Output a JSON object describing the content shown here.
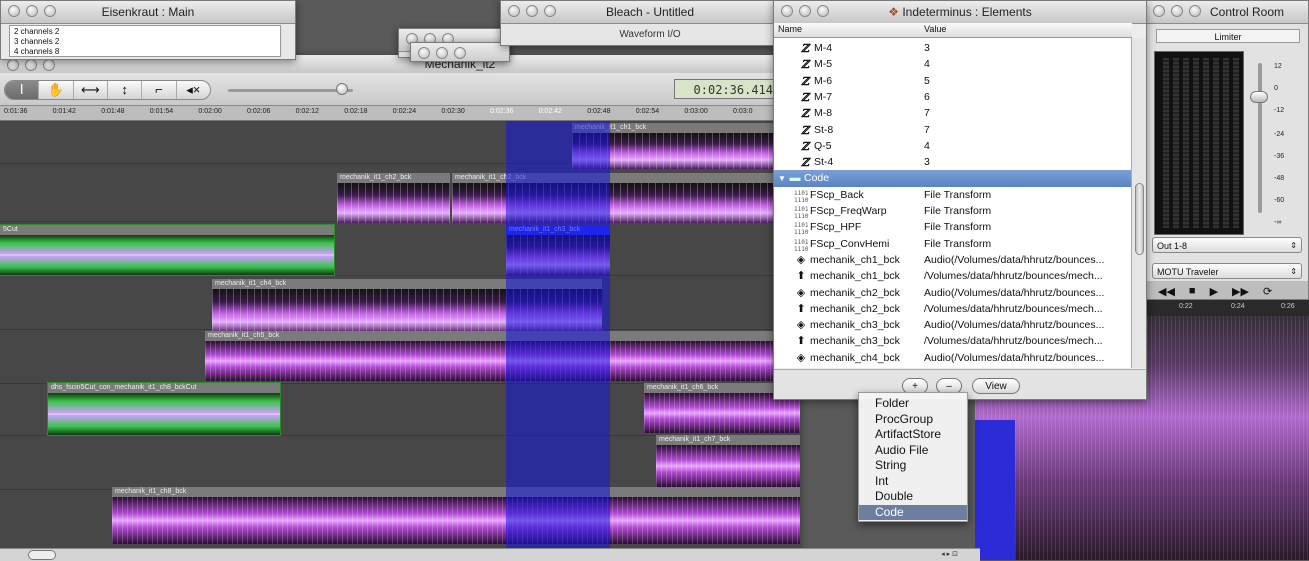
{
  "eisenkraut": {
    "title": "Eisenkraut : Main",
    "lines": [
      "2  channels 2",
      "3  channels 2",
      "4  channels 8"
    ]
  },
  "bleach": {
    "title": "Bleach - Untitled",
    "subtitle": "Waveform I/O"
  },
  "mechanik": {
    "title": "Mechanik_it2",
    "timecode": "0:02:36.414",
    "tools": [
      "Ⅰ",
      "✋",
      "⟷",
      "↕",
      "⌐",
      "◂×"
    ],
    "ruler_ticks": [
      "0:01:36",
      "0:01:42",
      "0:01:48",
      "0:01:54",
      "0:02:00",
      "0:02:06",
      "0:02:12",
      "0:02:18",
      "0:02:24",
      "0:02:30",
      "0:02:36",
      "0:02:42",
      "0:02:48",
      "0:02:54",
      "0:03:00",
      "0:03:0"
    ],
    "regions": [
      {
        "label": "mechanik_it1_ch1_bck"
      },
      {
        "label": "mechanik_it1_ch2_bck"
      },
      {
        "label": "mechanik_it1_ch2_bck"
      },
      {
        "label": "5Cut"
      },
      {
        "label": "mechanik_it1_ch3_bck"
      },
      {
        "label": "mechanik_it1_ch4_bck"
      },
      {
        "label": "mechanik_it1_ch5_bck"
      },
      {
        "label": "dhs_fscin5Cut_con_mechanik_it1_ch8_bckCut"
      },
      {
        "label": "mechanik_it1_ch6_bck"
      },
      {
        "label": "mechanik_it1_ch7_bck"
      },
      {
        "label": "mechanik_it1_ch8_bck"
      }
    ]
  },
  "elements": {
    "title": "Indeterminus : Elements",
    "col_name": "Name",
    "col_value": "Value",
    "rows": [
      {
        "name": "M-4",
        "value": "3",
        "icon": "Z"
      },
      {
        "name": "M-5",
        "value": "4",
        "icon": "Z"
      },
      {
        "name": "M-6",
        "value": "5",
        "icon": "Z"
      },
      {
        "name": "M-7",
        "value": "6",
        "icon": "Z"
      },
      {
        "name": "M-8",
        "value": "7",
        "icon": "Z"
      },
      {
        "name": "St-8",
        "value": "7",
        "icon": "Z"
      },
      {
        "name": "Q-5",
        "value": "4",
        "icon": "Z"
      },
      {
        "name": "St-4",
        "value": "3",
        "icon": "Z"
      },
      {
        "name": "Code",
        "value": "",
        "icon": "folder"
      },
      {
        "name": "FScp_Back",
        "value": "File Transform",
        "icon": "1101\n1110"
      },
      {
        "name": "FScp_FreqWarp",
        "value": "File Transform",
        "icon": "1101\n1110"
      },
      {
        "name": "FScp_HPF",
        "value": "File Transform",
        "icon": "1101\n1110"
      },
      {
        "name": "FScp_ConvHemi",
        "value": "File Transform",
        "icon": "1101\n1110"
      },
      {
        "name": "mechanik_ch1_bck",
        "value": "Audio(/Volumes/data/hhrutz/bounces...",
        "icon": "audio"
      },
      {
        "name": "mechanik_ch1_bck",
        "value": "/Volumes/data/hhrutz/bounces/mech...",
        "icon": "file"
      },
      {
        "name": "mechanik_ch2_bck",
        "value": "Audio(/Volumes/data/hhrutz/bounces...",
        "icon": "audio"
      },
      {
        "name": "mechanik_ch2_bck",
        "value": "/Volumes/data/hhrutz/bounces/mech...",
        "icon": "file"
      },
      {
        "name": "mechanik_ch3_bck",
        "value": "Audio(/Volumes/data/hhrutz/bounces...",
        "icon": "audio"
      },
      {
        "name": "mechanik_ch3_bck",
        "value": "/Volumes/data/hhrutz/bounces/mech...",
        "icon": "file"
      },
      {
        "name": "mechanik_ch4_bck",
        "value": "Audio(/Volumes/data/hhrutz/bounces...",
        "icon": "audio"
      }
    ],
    "buttons": {
      "add": "+",
      "remove": "–",
      "view": "View"
    }
  },
  "menu": {
    "items": [
      "Folder",
      "ProcGroup",
      "ArtifactStore",
      "Audio File",
      "String",
      "Int",
      "Double",
      "Code"
    ],
    "selected": "Code"
  },
  "control_room": {
    "title": "Control Room",
    "limiter": "Limiter",
    "scale": [
      "12",
      "0",
      "-12",
      "-24",
      "-36",
      "-48",
      "-60",
      "-∞"
    ],
    "output": "Out 1-8",
    "device": "MOTU Traveler",
    "transport": [
      "◀◀",
      "■",
      "▶",
      "▶▶",
      "⟳"
    ],
    "times": [
      "0:22",
      "0:24",
      "0:26"
    ]
  },
  "colors": {
    "selection": "#2b38ff",
    "menu_highlight": "#6d7e9e",
    "folder_row": "#5a84c2"
  }
}
